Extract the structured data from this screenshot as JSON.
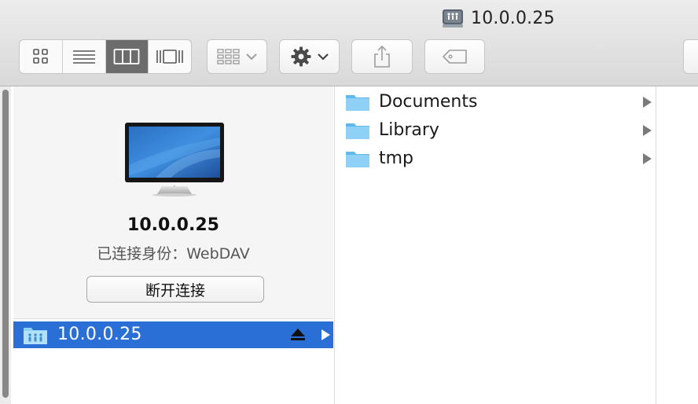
{
  "window": {
    "title": "10.0.0.25"
  },
  "toolbar": {
    "view_buttons": [
      "icon-view",
      "list-view",
      "column-view",
      "cover-flow-view"
    ],
    "active_view": "column-view",
    "arrange_icon": "arrange-grid-icon",
    "action_icon": "gear-icon",
    "share_icon": "share-icon",
    "tag_icon": "tag-icon"
  },
  "preview": {
    "name": "10.0.0.25",
    "status": "已连接身份：WebDAV",
    "disconnect_label": "断开连接"
  },
  "sidebar_column": {
    "items": [
      {
        "label": "10.0.0.25",
        "selected": true,
        "icon": "network-volume-icon"
      }
    ]
  },
  "folder_column": {
    "items": [
      {
        "label": "Documents",
        "icon": "folder-icon"
      },
      {
        "label": "Library",
        "icon": "folder-icon"
      },
      {
        "label": "tmp",
        "icon": "folder-icon"
      }
    ]
  },
  "colors": {
    "selection": "#2a6fd6",
    "folder": "#6fc3f0"
  }
}
